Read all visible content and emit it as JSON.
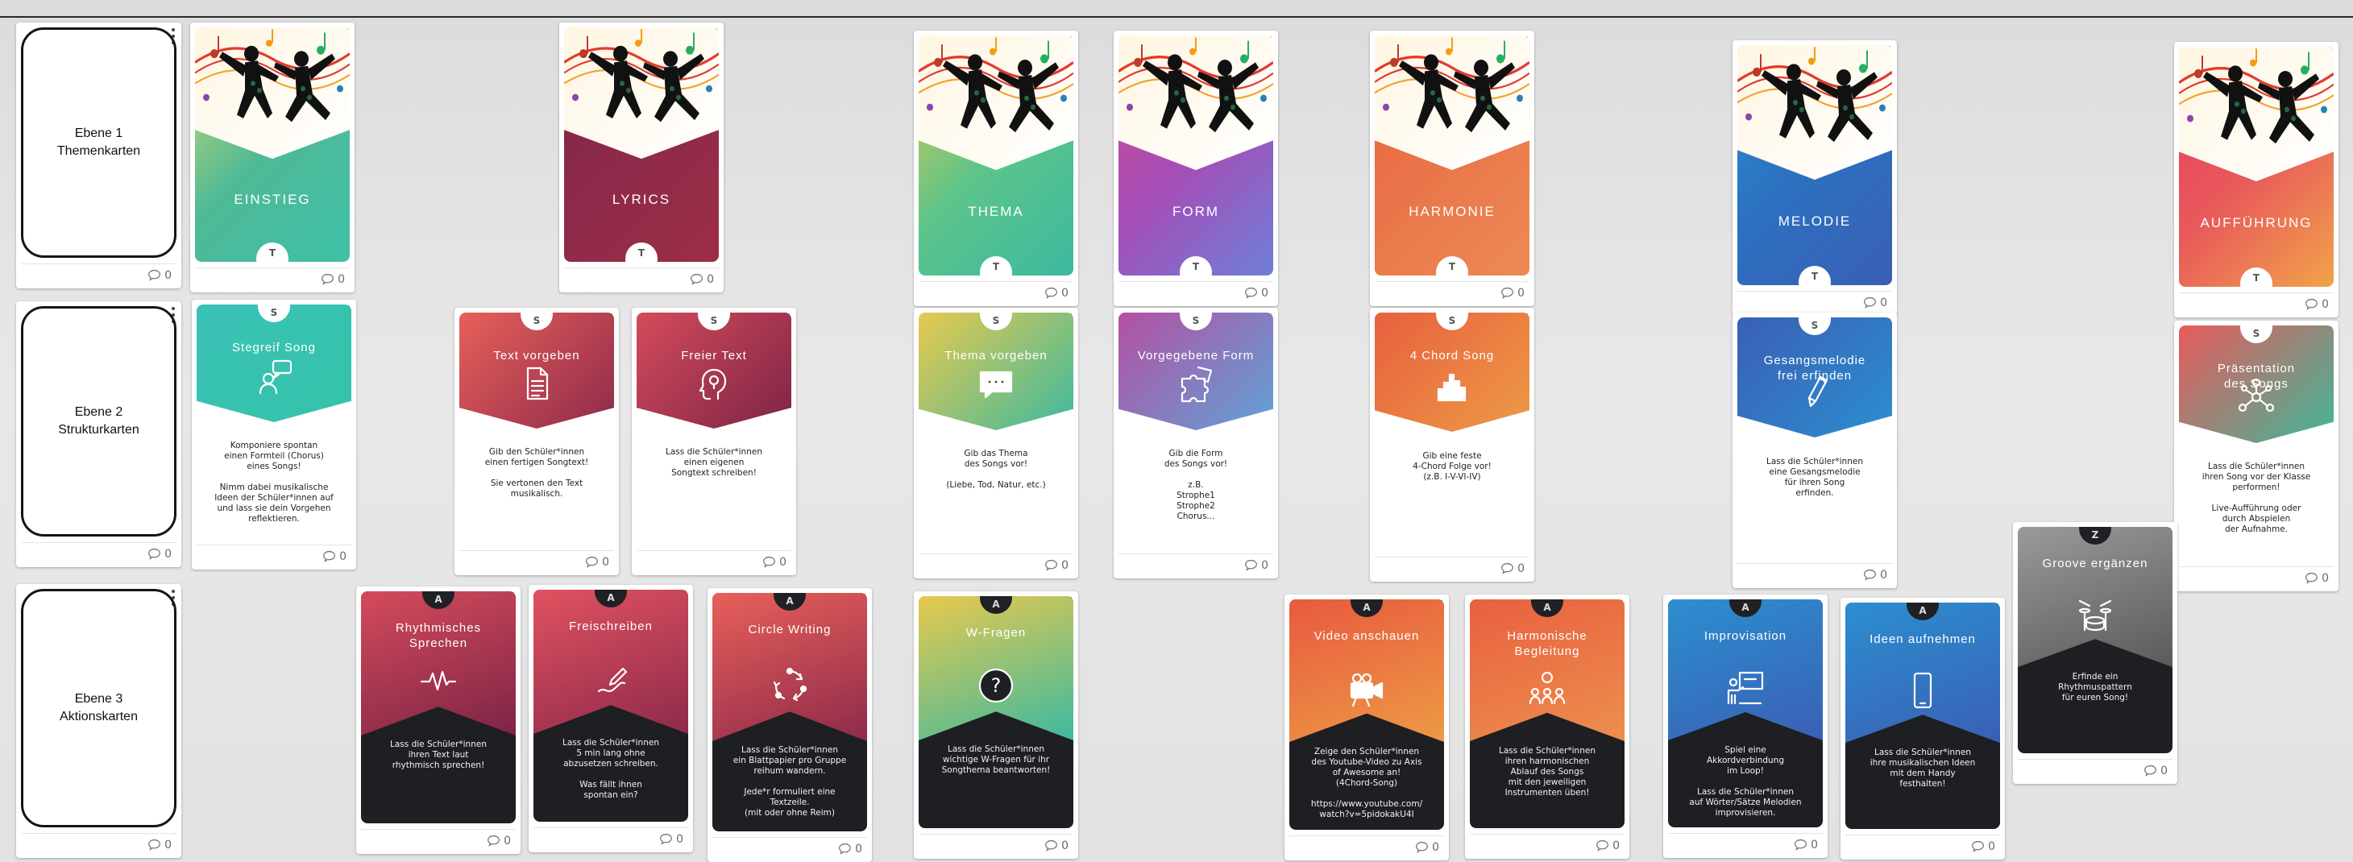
{
  "board": {
    "background": "#e3e3e3"
  },
  "levels": [
    {
      "label": "Ebene 1\nThemenkarten",
      "comments": "0"
    },
    {
      "label": "Ebene 2\nStrukturkarten",
      "comments": "0"
    },
    {
      "label": "Ebene 3\nAktionskarten",
      "comments": "0"
    }
  ],
  "theme_cards": [
    {
      "title": "EINSTIEG",
      "tab": "T",
      "colors": [
        "#d9dd6b",
        "#4fb996",
        "#3ec0a8"
      ],
      "comments": "0"
    },
    {
      "title": "LYRICS",
      "tab": "T",
      "colors": [
        "#7d2446",
        "#8e2a4a",
        "#9c2d46"
      ],
      "comments": "0"
    },
    {
      "title": "THEMA",
      "tab": "T",
      "colors": [
        "#e8c94d",
        "#5cc48a",
        "#3db9a0"
      ],
      "comments": "0"
    },
    {
      "title": "FORM",
      "tab": "T",
      "colors": [
        "#cf4a8e",
        "#a44eb7",
        "#6f7fd8"
      ],
      "comments": "0"
    },
    {
      "title": "HARMONIE",
      "tab": "T",
      "colors": [
        "#e8613f",
        "#e9764a",
        "#ed8a55"
      ],
      "comments": "0"
    },
    {
      "title": "MELODIE",
      "tab": "T",
      "colors": [
        "#2a8fd0",
        "#2d6fbf",
        "#3a5fb4"
      ],
      "comments": "0"
    },
    {
      "title": "AUFFÜHRUNG",
      "tab": "T",
      "colors": [
        "#e93c5e",
        "#e85a5b",
        "#f1a34a"
      ],
      "comments": "0"
    }
  ],
  "structure_cards": [
    {
      "title": "Stegreif Song",
      "tab": "S",
      "icon": "speech-bubble-person-icon",
      "colors": [
        "#3ac1b6",
        "#34c3a9"
      ],
      "description": "Komponiere spontan\neinen Formteil (Chorus)\neines Songs!\n\nNimm dabei musikalische\nIdeen der Schüler*innen auf\nund lass sie dein Vorgehen\nreflektieren.",
      "comments": "0"
    },
    {
      "title": "Text vorgeben",
      "tab": "S",
      "icon": "document-icon",
      "colors": [
        "#e8605a",
        "#8e2a4a"
      ],
      "description": "Gib den Schüler*innen\neinen fertigen Songtext!\n\nSie vertonen den Text\nmusikalisch.",
      "comments": "0"
    },
    {
      "title": "Freier Text",
      "tab": "S",
      "icon": "head-lightbulb-icon",
      "colors": [
        "#d44b5b",
        "#7d2446"
      ],
      "description": "Lass die Schüler*innen\neinen eigenen\nSongtext schreiben!",
      "comments": "0"
    },
    {
      "title": "Thema vorgeben",
      "tab": "S",
      "icon": "chat-bubble-icon",
      "colors": [
        "#e8c94d",
        "#3db9a0"
      ],
      "description": "Gib das Thema\ndes Songs vor!\n\n(Liebe, Tod, Natur, etc.)",
      "comments": "0"
    },
    {
      "title": "Vorgegebene Form",
      "tab": "S",
      "icon": "puzzle-icon",
      "colors": [
        "#b54fa3",
        "#5fa3d6"
      ],
      "description": "Gib die Form\ndes Songs vor!\n\nz.B.\nStrophe1\nStrophe2\nChorus...",
      "comments": "0"
    },
    {
      "title": "4 Chord Song",
      "tab": "S",
      "icon": "equalizer-icon",
      "colors": [
        "#e8603f",
        "#ed9a45"
      ],
      "description": "Gib eine feste\n4-Chord Folge vor!\n(z.B. I-V-VI-IV)",
      "comments": "0"
    },
    {
      "title": "Gesangsmelodie\nfrei erfinden",
      "tab": "S",
      "icon": "pen-icon",
      "colors": [
        "#3a5fb4",
        "#2c8fcf"
      ],
      "description": "Lass die Schüler*innen\neine Gesangsmelodie\nfür ihren Song\nerfinden.",
      "comments": "0"
    },
    {
      "title": "Präsentation\ndes Songs",
      "tab": "S",
      "icon": "network-icon",
      "colors": [
        "#e85a5b",
        "#3fb79a"
      ],
      "description": "Lass die Schüler*innen\nihren Song vor der Klasse\nperformen!\n\nLive-Aufführung oder\ndurch Abspielen\nder Aufnahme.",
      "comments": "0"
    }
  ],
  "action_cards": [
    {
      "title": "Rhythmisches\nSprechen",
      "tab": "A",
      "icon": "waveform-icon",
      "colors": [
        "#d44b5b",
        "#7d2446"
      ],
      "description": "Lass die Schüler*innen\nihren Text laut\nrhythmisch sprechen!",
      "comments": "0"
    },
    {
      "title": "Freischreiben",
      "tab": "A",
      "icon": "pencil-scribble-icon",
      "colors": [
        "#e05260",
        "#8e2a4a"
      ],
      "description": "Lass die Schüler*innen\n5 min lang ohne\nabzusetzen schreiben.\n\nWas fällt ihnen\nspontan ein?",
      "comments": "0"
    },
    {
      "title": "Circle Writing",
      "tab": "A",
      "icon": "cycle-arrows-icon",
      "colors": [
        "#e8605a",
        "#8e2a4a"
      ],
      "description": "Lass die Schüler*innen\nein Blattpapier pro Gruppe\nreihum wandern.\n\nJede*r formuliert eine\nTextzeile.\n(mit oder ohne Reim)",
      "comments": "0"
    },
    {
      "title": "W-Fragen",
      "tab": "A",
      "icon": "question-icon",
      "colors": [
        "#e8c94d",
        "#3db9a0"
      ],
      "description": "Lass die Schüler*innen\nwichtige W-Fragen für ihr\nSongthema beantworten!",
      "comments": "0"
    },
    {
      "title": "Video anschauen",
      "tab": "A",
      "icon": "video-camera-icon",
      "colors": [
        "#e85a3f",
        "#ed9a45"
      ],
      "description": "Zeige den Schüler*innen\ndes Youtube-Video zu Axis\nof Awesome an!\n(4Chord-Song)\n\nhttps://www.youtube.com/\nwatch?v=5pidokakU4I",
      "comments": "0"
    },
    {
      "title": "Harmonische\nBegleitung",
      "tab": "A",
      "icon": "group-icon",
      "colors": [
        "#e8603f",
        "#ed8f4e"
      ],
      "description": "Lass die Schüler*innen\nihren harmonischen\nAblauf des Songs\nmit den jeweiligen\nInstrumenten üben!",
      "comments": "0"
    },
    {
      "title": "Improvisation",
      "tab": "A",
      "icon": "teacher-board-icon",
      "colors": [
        "#2c8fcf",
        "#3a5fb4"
      ],
      "description": "Spiel eine\nAkkordverbindung\nim Loop!\n\nLass die Schüler*innen\nauf Wörter/Sätze Melodien\nimprovisieren.",
      "comments": "0"
    },
    {
      "title": "Ideen aufnehmen",
      "tab": "A",
      "icon": "smartphone-icon",
      "colors": [
        "#2c8fcf",
        "#3a5fb4"
      ],
      "description": "Lass die Schüler*innen\nihre musikalischen Ideen\nmit dem Handy\nfesthalten!",
      "comments": "0"
    },
    {
      "title": "Groove ergänzen",
      "tab": "Z",
      "icon": "drum-kit-icon",
      "colors": [
        "#9a9a9a",
        "#5a5a5a"
      ],
      "description": "Erfinde ein\nRhythmuspattern\nfür euren Song!",
      "comments": "0"
    }
  ]
}
